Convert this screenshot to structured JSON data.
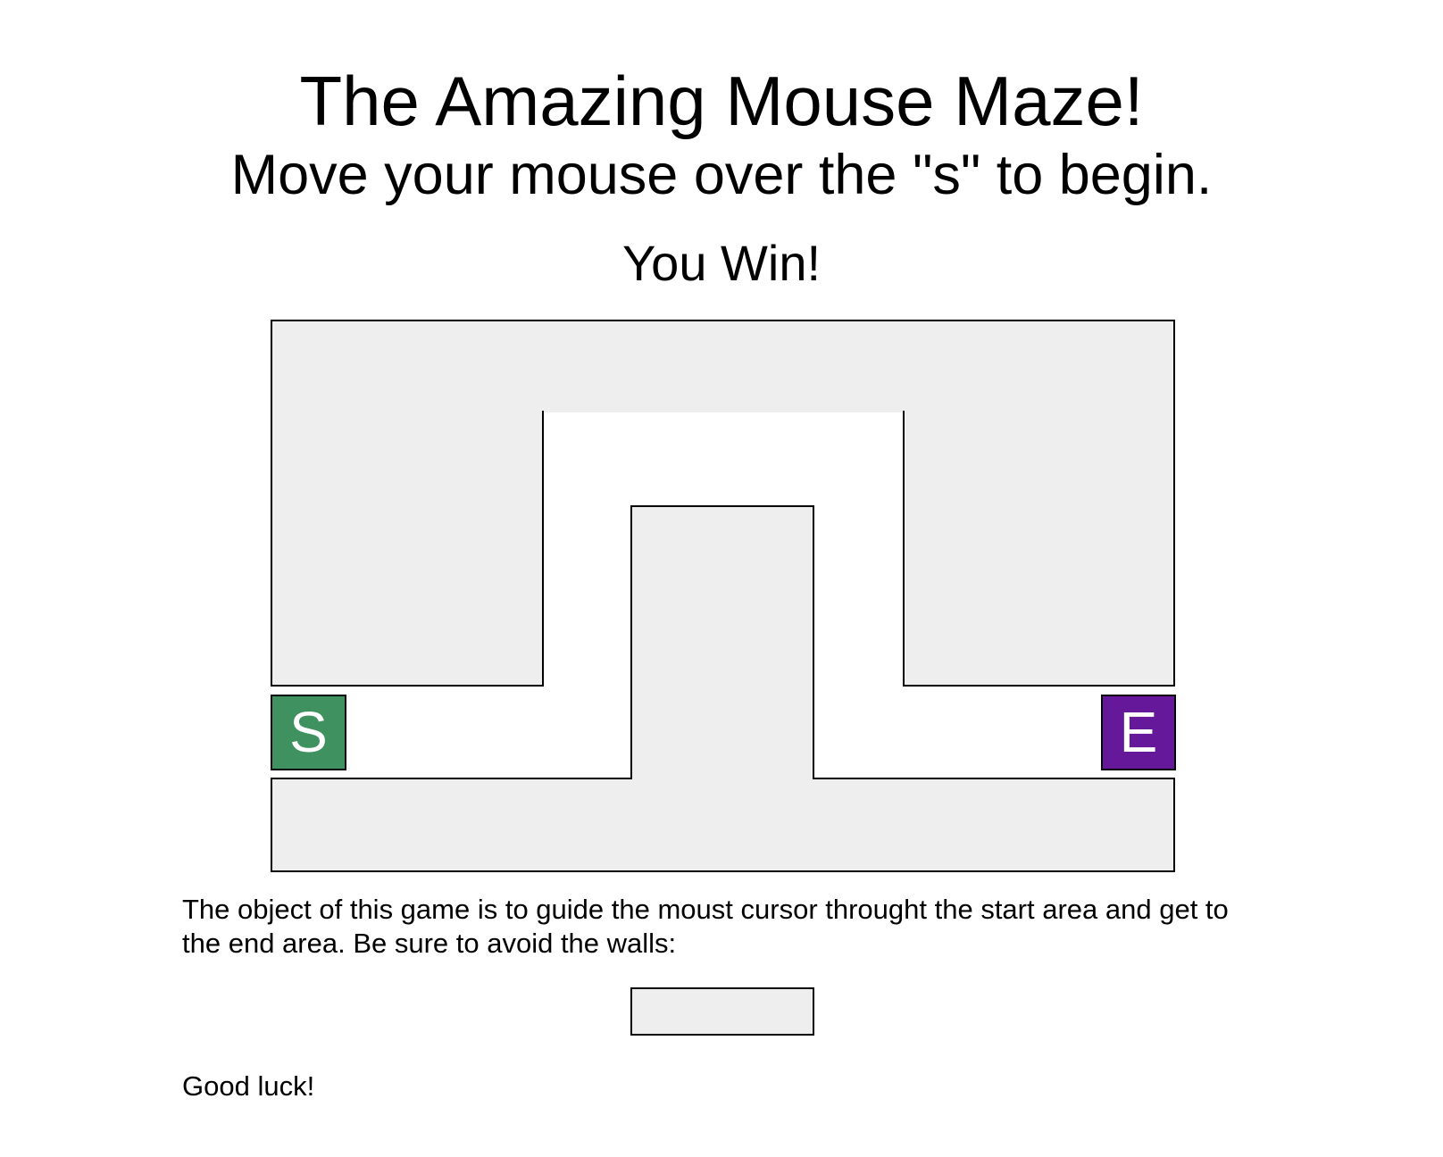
{
  "header": {
    "title": "The Amazing Mouse Maze!",
    "subtitle": "Move your mouse over the \"s\" to begin.",
    "status": "You Win!"
  },
  "maze": {
    "start_label": "S",
    "end_label": "E",
    "wall_color": "#eeeeee",
    "start_color": "#3f9260",
    "end_color": "#65189a"
  },
  "instructions": {
    "description": "The object of this game is to guide the moust cursor throught the start area and get to the end area. Be sure to avoid the walls:",
    "closing": "Good luck!"
  }
}
